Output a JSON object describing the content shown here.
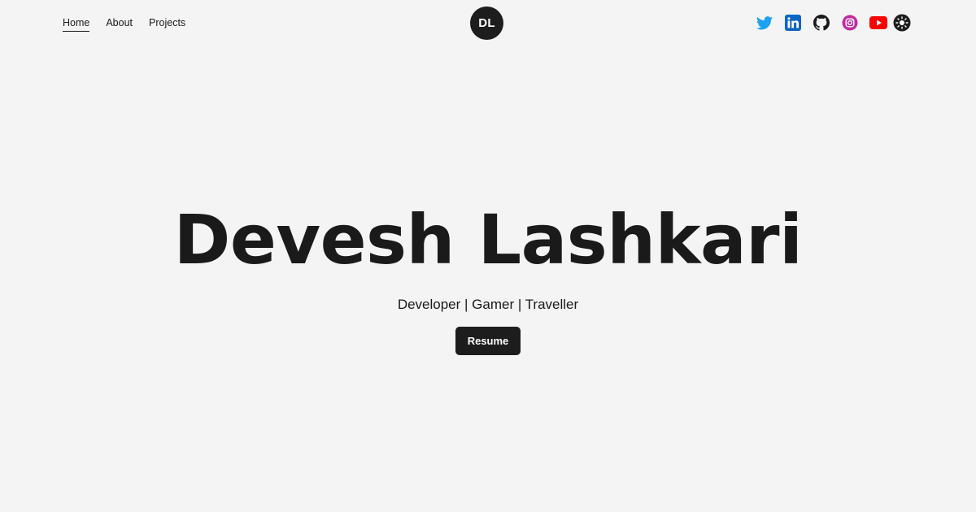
{
  "nav": {
    "links": [
      {
        "label": "Home",
        "active": true
      },
      {
        "label": "About",
        "active": false
      },
      {
        "label": "Projects",
        "active": false
      }
    ]
  },
  "logo": {
    "initials": "DL"
  },
  "socials": {
    "icons": [
      "twitter-icon",
      "linkedin-icon",
      "github-icon",
      "instagram-icon",
      "youtube-icon",
      "theme-toggle-icon"
    ]
  },
  "hero": {
    "name": "Devesh Lashkari",
    "tagline": "Developer | Gamer | Traveller",
    "resume_label": "Resume"
  },
  "colors": {
    "background": "#f4f4f4",
    "text": "#1a1a1a",
    "button": "#1d1d1d",
    "twitter": "#1da1f2",
    "linkedin": "#0a66c2",
    "instagram": "#c32aa3",
    "youtube": "#ff0000"
  }
}
